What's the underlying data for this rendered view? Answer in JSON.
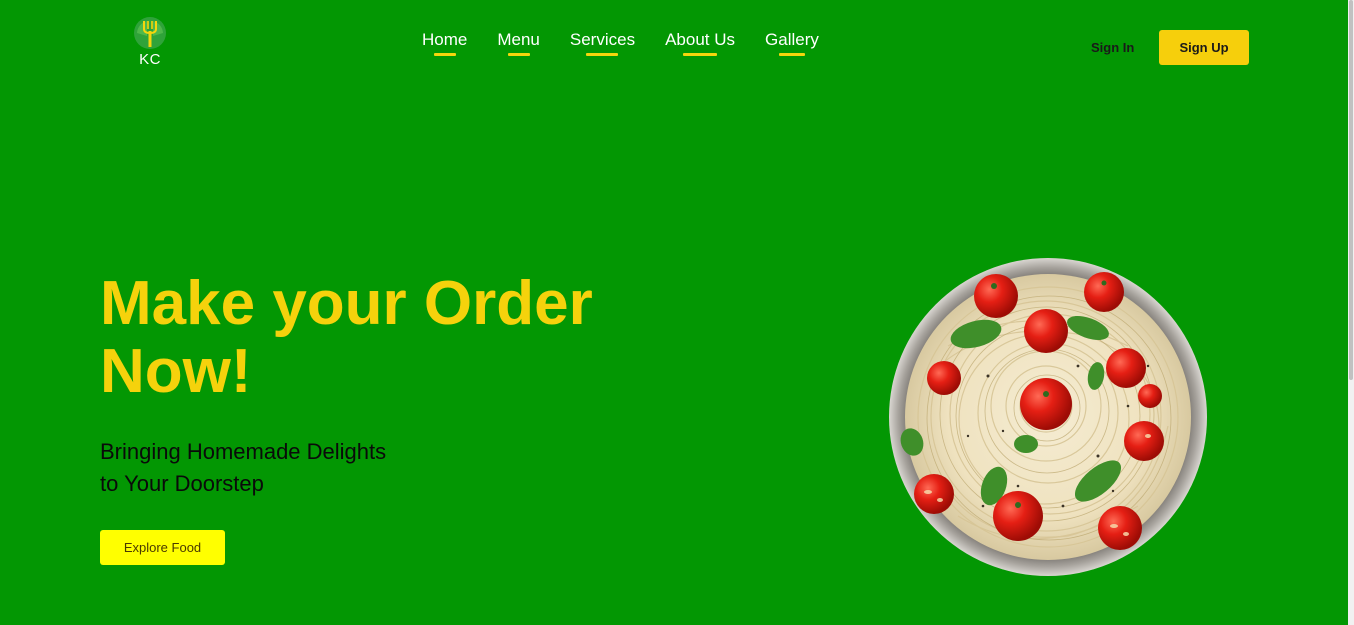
{
  "header": {
    "logo_text": "KC",
    "nav": [
      {
        "label": "Home"
      },
      {
        "label": "Menu"
      },
      {
        "label": "Services"
      },
      {
        "label": "About Us"
      },
      {
        "label": "Gallery"
      }
    ],
    "signin_label": "Sign In",
    "signup_label": "Sign Up"
  },
  "hero": {
    "title": "Make your Order Now!",
    "subtitle_line1": "Bringing Homemade Delights",
    "subtitle_line2": "to Your Doorstep",
    "cta_label": "Explore Food",
    "image_icon": "spaghetti-bowl-image"
  },
  "colors": {
    "background": "#039703",
    "accent_yellow": "#f5d20c",
    "button_yellow": "#ffff00",
    "signup_yellow": "#f6cf0c"
  }
}
